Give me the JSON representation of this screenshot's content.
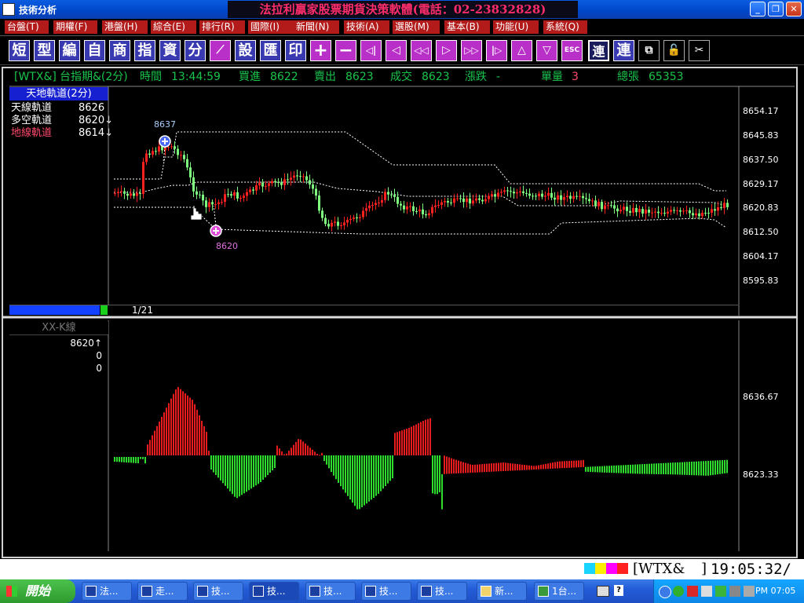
{
  "window": {
    "title": "技術分析",
    "promo": "法拉利贏家股票期貨決策軟體(電話：02-23832828)"
  },
  "menu": [
    "台盤(T)",
    "期權(F)",
    "港盤(H)",
    "綜合(E)",
    "排行(R)",
    "國際(I)",
    "新聞(N)",
    "技術(A)",
    "選股(M)",
    "基本(B)",
    "功能(U)",
    "系統(Q)"
  ],
  "toolbar": [
    "短",
    "型",
    "編",
    "自",
    "商",
    "指",
    "資",
    "分",
    "",
    "設",
    "匯",
    "印",
    "+",
    "−",
    "◁|",
    "◁",
    "◁◁",
    "▷",
    "▷▷",
    "|▷",
    "△",
    "▽",
    "ESC",
    "連",
    "連",
    "",
    "",
    ""
  ],
  "quote": {
    "symbol": "[WTX&]",
    "name": "台指期&(2分)",
    "time_label": "時間",
    "time": "13:44:59",
    "bid_label": "買進",
    "bid": "8622",
    "ask_label": "賣出",
    "ask": "8623",
    "last_label": "成交",
    "last": "8623",
    "change_label": "漲跌",
    "change": "-",
    "volume_label": "單量",
    "volume": "3",
    "total_label": "總張",
    "total": "65353"
  },
  "indicator": {
    "title": "天地軌道(2分)",
    "lines": [
      {
        "name": "天線軌道",
        "value": "8626",
        "color": "#ffffff"
      },
      {
        "name": "多空軌道",
        "value": "8620↓",
        "color": "#ffffff"
      },
      {
        "name": "地線軌道",
        "value": "8614↓",
        "color": "#ff4a6a"
      }
    ]
  },
  "price_axis": [
    "8654.17",
    "8645.83",
    "8637.50",
    "8629.17",
    "8620.83",
    "8612.50",
    "8604.17",
    "8595.83"
  ],
  "annotations": {
    "high": "8637",
    "low": "8620"
  },
  "page_indicator": "1/21",
  "sub_chart": {
    "title": "XX-K線",
    "values": [
      "8620↑",
      "0",
      "0"
    ],
    "axis": [
      "8636.67",
      "8623.33"
    ]
  },
  "colors": {
    "up": "#ff2020",
    "down": "#7fff7f",
    "band": "#ffffff",
    "hist_up": "#e81c1c",
    "hist_down": "#2edc2e"
  },
  "status": {
    "symbol": "[WTX&",
    "bracket": "]",
    "clock": "19:05:32/"
  },
  "taskbar": {
    "start": "開始",
    "tasks": [
      "法...",
      "走...",
      "技...",
      "技...",
      "技...",
      "技...",
      "技...",
      "新...",
      "1台..."
    ],
    "time": "PM 07:05"
  }
}
